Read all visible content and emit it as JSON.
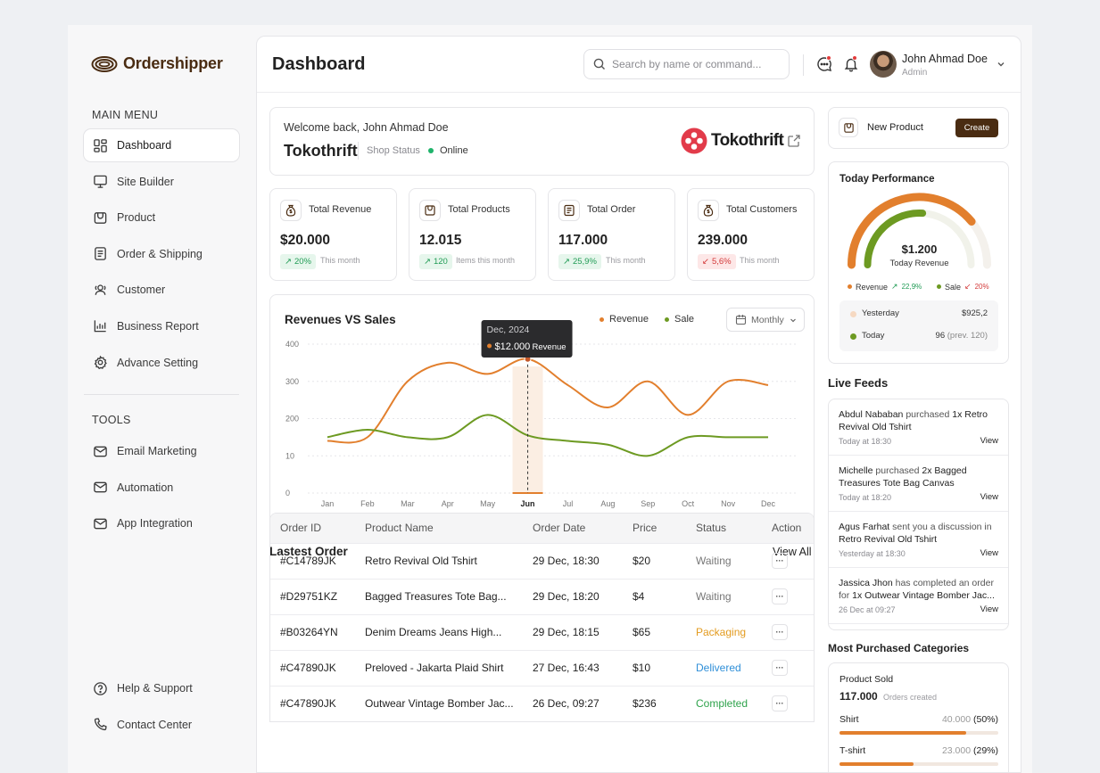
{
  "app": {
    "name": "Ordershipper"
  },
  "sidebar": {
    "main_menu_title": "MAIN MENU",
    "items": [
      {
        "label": "Dashboard",
        "icon": "dashboard-icon",
        "active": true
      },
      {
        "label": "Site Builder",
        "icon": "monitor-icon"
      },
      {
        "label": "Product",
        "icon": "box-icon"
      },
      {
        "label": "Order & Shipping",
        "icon": "document-icon"
      },
      {
        "label": "Customer",
        "icon": "users-icon"
      },
      {
        "label": "Business Report",
        "icon": "chart-icon"
      },
      {
        "label": "Advance Setting",
        "icon": "gear-icon"
      }
    ],
    "tools_title": "TOOLS",
    "tools": [
      {
        "label": "Email Marketing",
        "icon": "mail-icon"
      },
      {
        "label": "Automation",
        "icon": "mail-icon"
      },
      {
        "label": "App Integration",
        "icon": "mail-icon"
      }
    ],
    "footer": [
      {
        "label": "Help & Support",
        "icon": "help-icon"
      },
      {
        "label": "Contact Center",
        "icon": "phone-icon"
      }
    ]
  },
  "header": {
    "title": "Dashboard",
    "search_placeholder": "Search by name or command...",
    "user_name": "John Ahmad Doe",
    "user_role": "Admin"
  },
  "welcome": {
    "greeting": "Welcome back, John Ahmad Doe",
    "shop_name": "Tokothrift",
    "status_label": "Shop Status",
    "status_value": "Online",
    "brand": "Tokothrift"
  },
  "stats": [
    {
      "label": "Total Revenue",
      "value": "$20.000",
      "change": "20%",
      "trend": "up",
      "note": "This month"
    },
    {
      "label": "Total Products",
      "value": "12.015",
      "change": "120",
      "trend": "up",
      "note": "Items this month"
    },
    {
      "label": "Total Order",
      "value": "117.000",
      "change": "25,9%",
      "trend": "up",
      "note": "This month"
    },
    {
      "label": "Total Customers",
      "value": "239.000",
      "change": "5,6%",
      "trend": "down",
      "note": "This month"
    }
  ],
  "chart_data": {
    "type": "line",
    "title": "Revenues VS Sales",
    "period": "Monthly",
    "categories": [
      "Jan",
      "Feb",
      "Mar",
      "Apr",
      "May",
      "Jun",
      "Jul",
      "Aug",
      "Sep",
      "Oct",
      "Nov",
      "Dec"
    ],
    "y_ticks": [
      "400",
      "300",
      "200",
      "10",
      "0"
    ],
    "tooltip": {
      "date": "Dec, 2024",
      "value": "$12.000",
      "series": "Revenue"
    },
    "highlight": "Jun",
    "colors": {
      "Revenue": "#e27f2d",
      "Sale": "#6d9a22"
    },
    "series": [
      {
        "name": "Revenue",
        "values": [
          140,
          150,
          300,
          350,
          320,
          360,
          290,
          230,
          300,
          210,
          300,
          290
        ]
      },
      {
        "name": "Sale",
        "values": [
          150,
          170,
          150,
          150,
          210,
          155,
          140,
          130,
          100,
          150,
          150,
          150
        ]
      }
    ]
  },
  "orders": {
    "title": "Lastest Order",
    "view_all": "View All",
    "columns": [
      "Order ID",
      "Product Name",
      "Order Date",
      "Price",
      "Status",
      "Action"
    ],
    "rows": [
      {
        "id": "#C14789JK",
        "product": "Retro Revival Old Tshirt",
        "date": "29 Dec, 18:30",
        "price": "$20",
        "status": "Waiting",
        "status_color": "#777777"
      },
      {
        "id": "#D29751KZ",
        "product": "Bagged Treasures Tote Bag...",
        "date": "29 Dec, 18:20",
        "price": "$4",
        "status": "Waiting",
        "status_color": "#777777"
      },
      {
        "id": "#B03264YN",
        "product": "Denim Dreams Jeans High...",
        "date": "29 Dec, 18:15",
        "price": "$65",
        "status": "Packaging",
        "status_color": "#e39b1f"
      },
      {
        "id": "#C47890JK",
        "product": "Preloved - Jakarta Plaid Shirt",
        "date": "27 Dec, 16:43",
        "price": "$10",
        "status": "Delivered",
        "status_color": "#2f8fd8"
      },
      {
        "id": "#C47890JK",
        "product": "Outwear Vintage Bomber Jac...",
        "date": "26 Dec, 09:27",
        "price": "$236",
        "status": "Completed",
        "status_color": "#2fa34c"
      }
    ]
  },
  "new_product": {
    "label": "New Product",
    "button": "Create"
  },
  "performance": {
    "title": "Today Performance",
    "amount": "$1.200",
    "amount_label": "Today Revenue",
    "revenue_level": 0.78,
    "sale_level": 0.52,
    "revenue_label": "Revenue",
    "revenue_change": "22,9%",
    "sale_label": "Sale",
    "sale_change": "20%",
    "yesterday_label": "Yesterday",
    "yesterday_value": "$925,2",
    "today_label": "Today",
    "today_value": "96",
    "today_prev": "(prev. 120)"
  },
  "live_feeds": {
    "title": "Live Feeds",
    "items": [
      {
        "actor": "Abdul Nababan",
        "action": " purchased ",
        "object": "1x Retro Revival Old Tshirt",
        "time": "Today at 18:30",
        "link": "View"
      },
      {
        "actor": "Michelle",
        "action": " purchased ",
        "object": "2x Bagged Treasures Tote Bag Canvas",
        "time": "Today at 18:20",
        "link": "View"
      },
      {
        "actor": "Agus Farhat",
        "action": " sent you a discussion in ",
        "object": "Retro Revival Old Tshirt",
        "time": "Yesterday at 18:30",
        "link": "View"
      },
      {
        "actor": "Jassica Jhon",
        "action": " has completed an order for ",
        "object": "1x Outwear Vintage Bomber Jac...",
        "time": "26 Dec at 09:27",
        "link": "View"
      }
    ]
  },
  "categories": {
    "title": "Most Purchased Categories",
    "sold_label": "Product Sold",
    "sold_value": "117.000",
    "sold_note": "Orders created",
    "items": [
      {
        "name": "Shirt",
        "count": "40.000",
        "pct": "(50%)",
        "share": 0.5
      },
      {
        "name": "T-shirt",
        "count": "23.000",
        "pct": "(29%)",
        "share": 0.29
      }
    ]
  }
}
